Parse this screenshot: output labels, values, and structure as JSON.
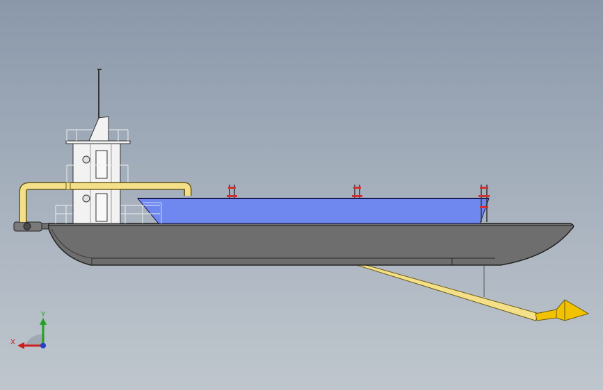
{
  "viewport": {
    "background_top": "#8a98aa",
    "background_bottom": "#bfc6cd"
  },
  "model": {
    "hull_color": "#6e6e6e",
    "hull_edge_color": "#222222",
    "cargo_hold_color": "#6f88f0",
    "pipe_color": "#f5e08a",
    "cutter_color": "#f2c200",
    "cabin_color": "#f2f2f2"
  },
  "triad": {
    "x_label": "X",
    "y_label": "Y",
    "x_color": "#cc1f1f",
    "y_color": "#1fa31f",
    "z_color": "#1f3fcc"
  }
}
